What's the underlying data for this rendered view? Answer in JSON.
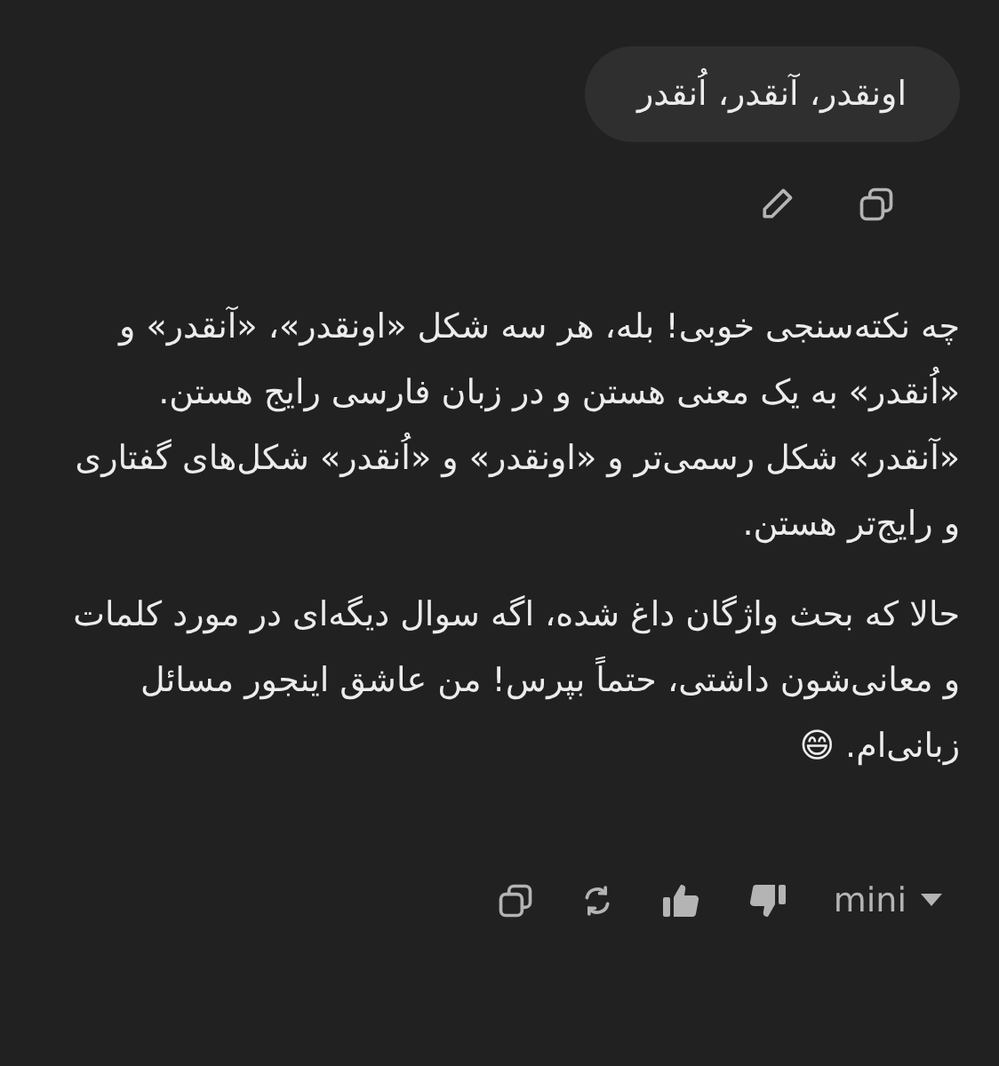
{
  "user_message": {
    "text": "اونقدر، آنقدر، اُنقدر"
  },
  "assistant_message": {
    "paragraphs": [
      "چه نکته‌سنجی خوبی! بله، هر سه شکل «اونقدر»، «آنقدر» و «اُنقدر» به یک معنی هستن و در زبان فارسی رایج هستن. «آنقدر» شکل رسمی‌تر و «اونقدر» و «اُنقدر» شکل‌های گفتاری و رایج‌تر هستن.",
      "حالا که بحث واژگان داغ شده، اگه سوال دیگه‌ای در مورد کلمات و معانی‌شون داشتی، حتماً بپرس! من عاشق اینجور مسائل زبانی‌ام. 😄"
    ]
  },
  "model_selector": {
    "label": "mini"
  }
}
